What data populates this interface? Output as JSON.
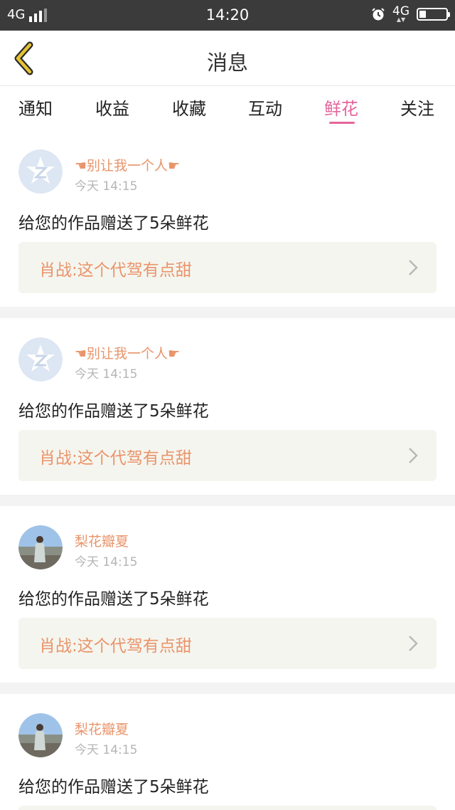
{
  "status_bar": {
    "network_left": "4G",
    "time": "14:20",
    "network_right": "4G"
  },
  "header": {
    "title": "消息"
  },
  "tabs": [
    {
      "label": "通知"
    },
    {
      "label": "收益"
    },
    {
      "label": "收藏"
    },
    {
      "label": "互动"
    },
    {
      "label": "鲜花",
      "active": true
    },
    {
      "label": "关注"
    }
  ],
  "items": [
    {
      "user": "☚别让我一个人☛",
      "avatar": "qq-default-avatar",
      "time": "今天 14:15",
      "message": "给您的作品赠送了5朵鲜花",
      "work": "肖战:这个代驾有点甜"
    },
    {
      "user": "☚别让我一个人☛",
      "avatar": "qq-default-avatar",
      "time": "今天 14:15",
      "message": "给您的作品赠送了5朵鲜花",
      "work": "肖战:这个代驾有点甜"
    },
    {
      "user": "梨花瓣夏",
      "avatar": "photo-avatar",
      "time": "今天 14:15",
      "message": "给您的作品赠送了5朵鲜花",
      "work": "肖战:这个代驾有点甜"
    },
    {
      "user": "梨花瓣夏",
      "avatar": "photo-avatar",
      "time": "今天 14:15",
      "message": "给您的作品赠送了5朵鲜花",
      "work": ""
    }
  ],
  "colors": {
    "accent": "#e5669b",
    "name": "#e9946a",
    "back_arrow": "#e6c332"
  }
}
